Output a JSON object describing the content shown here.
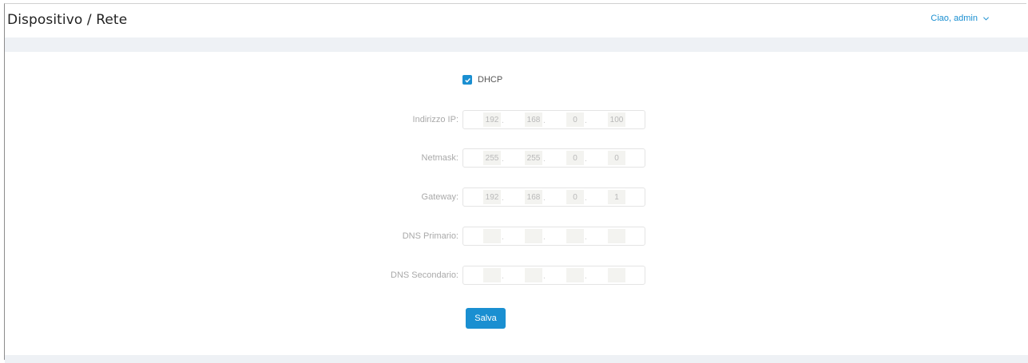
{
  "header": {
    "title": "Dispositivo / Rete",
    "user_greeting": "Ciao, admin",
    "user_menu_icon": "chevron-down-icon"
  },
  "form": {
    "dhcp": {
      "label": "DHCP",
      "checked": true
    },
    "fields": [
      {
        "label": "Indirizzo IP:",
        "octets": [
          "192",
          "168",
          "0",
          "100"
        ]
      },
      {
        "label": "Netmask:",
        "octets": [
          "255",
          "255",
          "0",
          "0"
        ]
      },
      {
        "label": "Gateway:",
        "octets": [
          "192",
          "168",
          "0",
          "1"
        ]
      },
      {
        "label": "DNS Primario:",
        "octets": [
          "",
          "",
          "",
          ""
        ]
      },
      {
        "label": "DNS Secondario:",
        "octets": [
          "",
          "",
          "",
          ""
        ]
      }
    ],
    "octet_separator": ".",
    "save_label": "Salva"
  },
  "colors": {
    "accent": "#1a8fd1",
    "band": "#eef1f5"
  }
}
